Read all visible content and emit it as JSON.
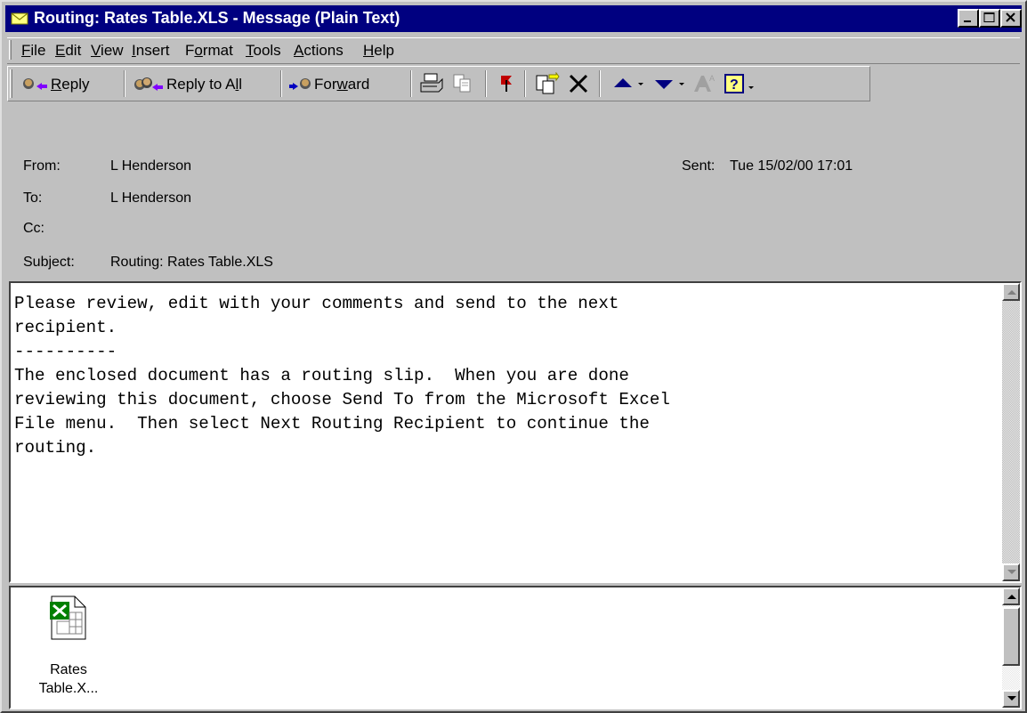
{
  "window": {
    "title": "Routing: Rates Table.XLS - Message (Plain Text)"
  },
  "menu": [
    {
      "prefix": "",
      "hotkey": "F",
      "suffix": "ile"
    },
    {
      "prefix": "",
      "hotkey": "E",
      "suffix": "dit"
    },
    {
      "prefix": "",
      "hotkey": "V",
      "suffix": "iew"
    },
    {
      "prefix": "",
      "hotkey": "I",
      "suffix": "nsert"
    },
    {
      "prefix": "F",
      "hotkey": "o",
      "suffix": "rmat"
    },
    {
      "prefix": "",
      "hotkey": "T",
      "suffix": "ools"
    },
    {
      "prefix": "",
      "hotkey": "A",
      "suffix": "ctions"
    },
    {
      "prefix": "",
      "hotkey": "H",
      "suffix": "elp"
    }
  ],
  "toolbar": {
    "reply": {
      "prefix": "",
      "hotkey": "R",
      "suffix": "eply"
    },
    "reply_all": {
      "prefix": "Reply to A",
      "hotkey": "l",
      "suffix": "l"
    },
    "forward": {
      "prefix": "For",
      "hotkey": "w",
      "suffix": "ard"
    },
    "icons": [
      "print-icon",
      "copy-icon",
      "flag-icon",
      "move-to-folder-icon",
      "delete-icon",
      "previous-item-icon",
      "next-item-icon",
      "font-size-icon",
      "help-icon"
    ]
  },
  "header": {
    "from_label": "From:",
    "from_value": "L Henderson",
    "sent_label": "Sent:",
    "sent_value": "Tue 15/02/00 17:01",
    "to_label": "To:",
    "to_value": "L Henderson",
    "cc_label": "Cc:",
    "cc_value": "",
    "subject_label": "Subject:",
    "subject_value": "Routing: Rates Table.XLS"
  },
  "body": {
    "text": "Please review, edit with your comments and send to the next\nrecipient.\n----------\nThe enclosed document has a routing slip.  When you are done\nreviewing this document, choose Send To from the Microsoft Excel\nFile menu.  Then select Next Routing Recipient to continue the\nrouting."
  },
  "attachment": {
    "name_line1": "Rates",
    "name_line2": "Table.X...",
    "icon": "excel-file-icon"
  },
  "colors": {
    "title_bar": "#000080",
    "face": "#c0c0c0"
  }
}
